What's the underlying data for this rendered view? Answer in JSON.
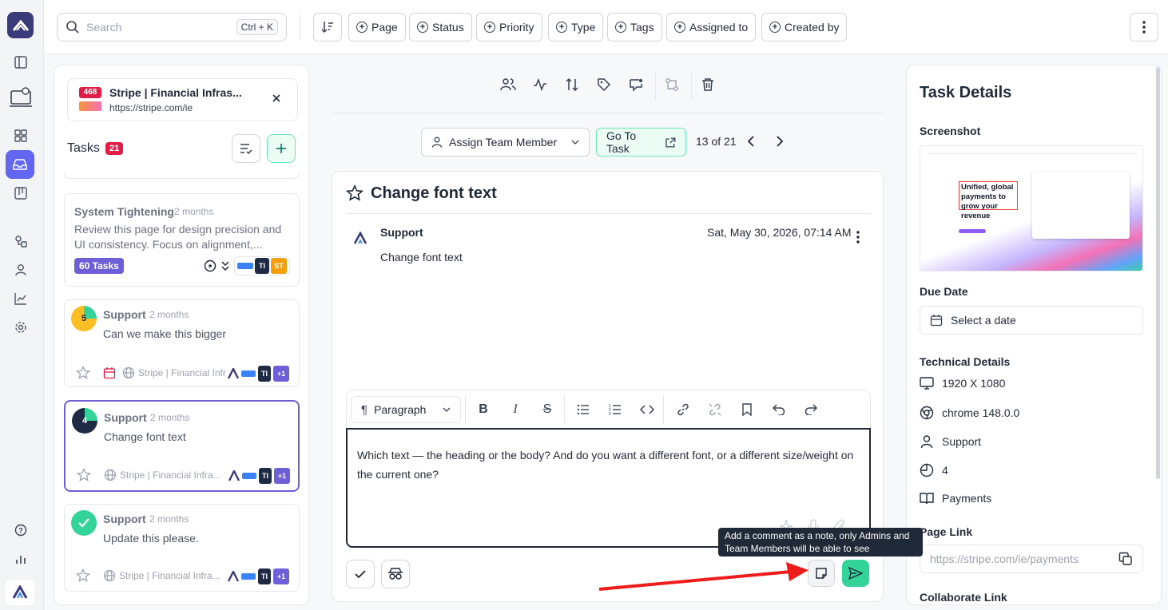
{
  "topbar": {
    "search_placeholder": "Search",
    "search_shortcut": "Ctrl + K",
    "filters": [
      "Page",
      "Status",
      "Priority",
      "Type",
      "Tags",
      "Assigned to",
      "Created by"
    ]
  },
  "site": {
    "badge": "468",
    "title": "Stripe | Financial Infras...",
    "url": "https://stripe.com/ie"
  },
  "tasks_header": {
    "label": "Tasks",
    "count": "21"
  },
  "group_card": {
    "title": "System Tightening",
    "time": "2 months",
    "desc1": "Review this page for design precision and",
    "desc2": "UI consistency. Focus on alignment,...",
    "badge": "60 Tasks",
    "chips": [
      "TI",
      "ST"
    ]
  },
  "task_cards": [
    {
      "num": "5",
      "author": "Support",
      "time": "2 months",
      "text": "Can we make this bigger",
      "site": "Stripe | Financial Infra",
      "more": "+1"
    },
    {
      "num": "4",
      "author": "Support",
      "time": "2 months",
      "text": "Change font text",
      "site": "Stripe | Financial Infra...",
      "more": "+1"
    },
    {
      "num": "",
      "author": "Support",
      "time": "2 months",
      "text": "Update this please.",
      "site": "Stripe | Financial Infra...",
      "more": "+1"
    }
  ],
  "nav": {
    "assign": "Assign Team Member",
    "goto": "Go To Task",
    "position": "13 of 21"
  },
  "task": {
    "title": "Change font text",
    "comment_author": "Support",
    "comment_date": "Sat, May 30, 2026, 07:14 AM",
    "comment_text": "Change font text"
  },
  "editor": {
    "block_type": "Paragraph",
    "content": "Which text — the heading or the body? And do you want a different font, or a different size/weight on the current one?"
  },
  "tooltip": "Add a comment as a note, only Admins and Team Members will be able to see",
  "details": {
    "title": "Task Details",
    "screenshot_label": "Screenshot",
    "hero_text": "Unified, global payments to grow your revenue",
    "due_label": "Due Date",
    "due_placeholder": "Select a date",
    "tech_label": "Technical Details",
    "resolution": "1920 X 1080",
    "browser": "chrome 148.0.0",
    "user": "Support",
    "priority": "4",
    "category": "Payments",
    "page_link_label": "Page Link",
    "page_link": "https://stripe.com/ie/payments",
    "collab_label": "Collaborate Link"
  },
  "colors": {
    "accent": "#6366f1",
    "green": "#34d399",
    "red": "#e11d48"
  }
}
